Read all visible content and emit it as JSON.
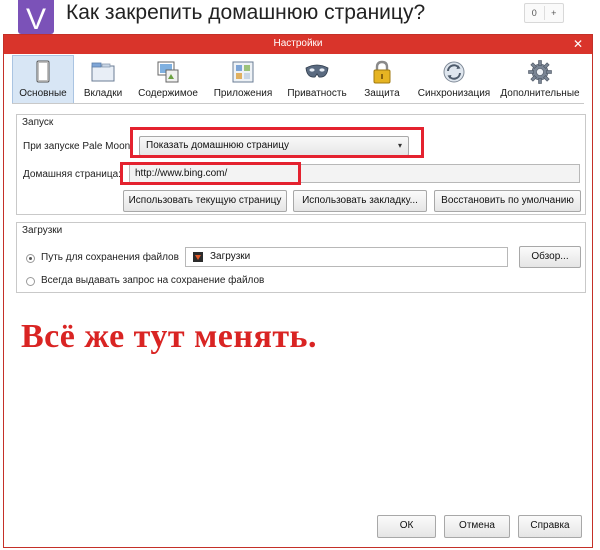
{
  "question": {
    "logo_letter": "V",
    "title": "Как закрепить домашнюю страницу?",
    "counter_value": "0",
    "counter_plus": "+"
  },
  "dialog": {
    "title": "Настройки",
    "close_glyph": "✕"
  },
  "toolbar": {
    "items": [
      {
        "label": "Основные",
        "icon": "general-icon"
      },
      {
        "label": "Вкладки",
        "icon": "tabs-icon"
      },
      {
        "label": "Содержимое",
        "icon": "content-icon"
      },
      {
        "label": "Приложения",
        "icon": "applications-icon"
      },
      {
        "label": "Приватность",
        "icon": "privacy-mask-icon"
      },
      {
        "label": "Защита",
        "icon": "lock-icon"
      },
      {
        "label": "Синхронизация",
        "icon": "sync-icon"
      },
      {
        "label": "Дополнительные",
        "icon": "gear-icon"
      }
    ],
    "active_index": 0
  },
  "startup": {
    "legend": "Запуск",
    "on_start_label": "При запуске Pale Moon:",
    "on_start_value": "Показать домашнюю страницу",
    "homepage_label": "Домашняя страница:",
    "homepage_value": "http://www.bing.com/",
    "use_current_label": "Использовать текущую страницу",
    "use_bookmark_label": "Использовать закладку...",
    "restore_default_label": "Восстановить по умолчанию"
  },
  "downloads": {
    "legend": "Загрузки",
    "save_path_label": "Путь для сохранения файлов",
    "save_path_value": "Загрузки",
    "browse_label": "Обзор...",
    "always_ask_label": "Всегда выдавать запрос на сохранение файлов",
    "selected": "save_path"
  },
  "annotation": {
    "text": "Всё же тут менять."
  },
  "footer": {
    "ok_label": "ОК",
    "cancel_label": "Отмена",
    "help_label": "Справка"
  },
  "colors": {
    "titlebar": "#d9342b",
    "highlight": "#e4222f",
    "annotation": "#d92423",
    "active_tab": "#d8e6f5",
    "logo": "#7b52b8"
  }
}
